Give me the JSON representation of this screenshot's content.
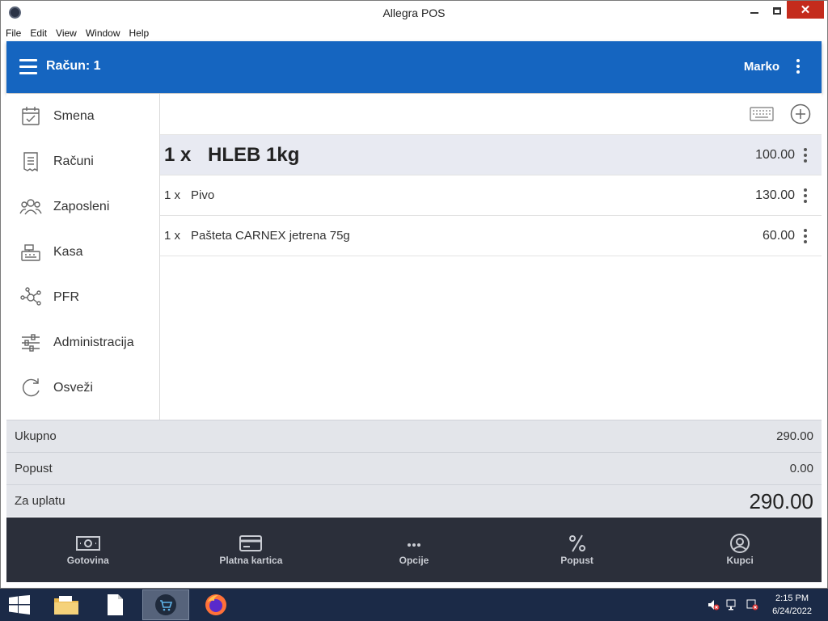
{
  "window": {
    "title": "Allegra POS"
  },
  "menu": [
    "File",
    "Edit",
    "View",
    "Window",
    "Help"
  ],
  "appbar": {
    "racun_label": "Račun: 1",
    "user": "Marko"
  },
  "sidebar": {
    "items": [
      {
        "label": "Smena",
        "icon": "calendar-check-icon"
      },
      {
        "label": "Računi",
        "icon": "receipt-icon"
      },
      {
        "label": "Zaposleni",
        "icon": "users-icon"
      },
      {
        "label": "Kasa",
        "icon": "cash-register-icon"
      },
      {
        "label": "PFR",
        "icon": "network-icon"
      },
      {
        "label": "Administracija",
        "icon": "sliders-icon"
      },
      {
        "label": "Osveži",
        "icon": "refresh-icon"
      }
    ]
  },
  "items": [
    {
      "qty": "1 x",
      "name": "HLEB 1kg",
      "price": "100.00"
    },
    {
      "qty": "1 x",
      "name": "Pivo",
      "price": "130.00"
    },
    {
      "qty": "1 x",
      "name": "Pašteta CARNEX jetrena 75g",
      "price": "60.00"
    }
  ],
  "totals": {
    "ukupno_label": "Ukupno",
    "ukupno": "290.00",
    "popust_label": "Popust",
    "popust": "0.00",
    "za_uplatu_label": "Za uplatu",
    "za_uplatu": "290.00"
  },
  "bottom": [
    {
      "label": "Gotovina",
      "icon": "cash-icon"
    },
    {
      "label": "Platna kartica",
      "icon": "card-icon"
    },
    {
      "label": "Opcije",
      "icon": "more-icon"
    },
    {
      "label": "Popust",
      "icon": "percent-icon"
    },
    {
      "label": "Kupci",
      "icon": "user-circle-icon"
    }
  ],
  "taskbar": {
    "time": "2:15 PM",
    "date": "6/24/2022"
  },
  "colors": {
    "appbar": "#1565c0",
    "bottombar": "#2b2f3a",
    "taskbar": "#1b2a47"
  }
}
